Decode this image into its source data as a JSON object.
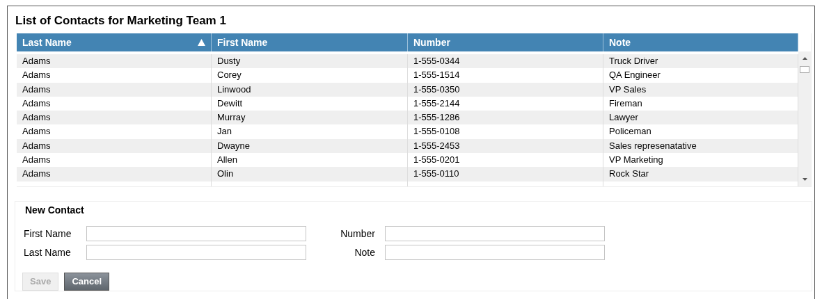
{
  "title": "List of Contacts for Marketing Team 1",
  "table": {
    "columns": [
      {
        "label": "Last Name",
        "sorted": true
      },
      {
        "label": "First Name",
        "sorted": false
      },
      {
        "label": "Number",
        "sorted": false
      },
      {
        "label": "Note",
        "sorted": false
      }
    ],
    "rows": [
      [
        "Adams",
        "Dusty",
        "1-555-0344",
        "Truck Driver"
      ],
      [
        "Adams",
        "Corey",
        "1-555-1514",
        "QA Engineer"
      ],
      [
        "Adams",
        "Linwood",
        "1-555-0350",
        "VP Sales"
      ],
      [
        "Adams",
        "Dewitt",
        "1-555-2144",
        "Fireman"
      ],
      [
        "Adams",
        "Murray",
        "1-555-1286",
        "Lawyer"
      ],
      [
        "Adams",
        "Jan",
        "1-555-0108",
        "Policeman"
      ],
      [
        "Adams",
        "Dwayne",
        "1-555-2453",
        "Sales represenatative"
      ],
      [
        "Adams",
        "Allen",
        "1-555-0201",
        "VP Marketing"
      ],
      [
        "Adams",
        "Olin",
        "1-555-0110",
        "Rock Star"
      ]
    ]
  },
  "form": {
    "legend": "New Contact",
    "fields": [
      {
        "label": "First Name"
      },
      {
        "label": "Number"
      },
      {
        "label": "Last Name"
      },
      {
        "label": "Note"
      }
    ],
    "buttons": [
      {
        "label": "Save",
        "disabled": true
      },
      {
        "label": "Cancel",
        "disabled": false
      }
    ]
  }
}
